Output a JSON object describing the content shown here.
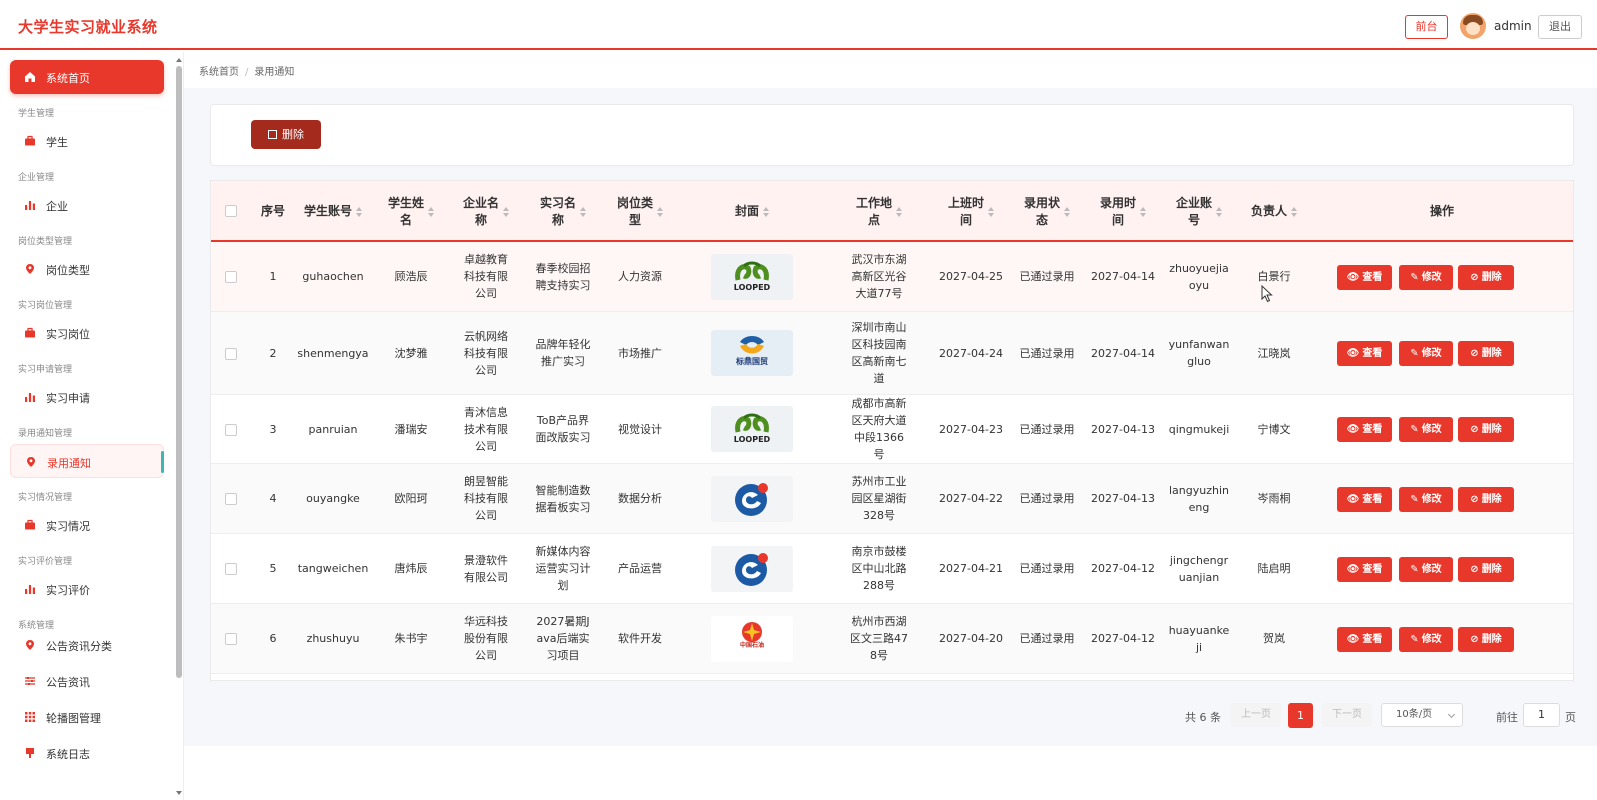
{
  "header": {
    "app_title": "大学生实习就业系统",
    "front_label": "前台",
    "username": "admin",
    "logout_label": "退出"
  },
  "sidebar": {
    "home": "系统首页",
    "groups": [
      {
        "title": "学生管理",
        "item": "学生",
        "icon": "briefcase-icon"
      },
      {
        "title": "企业管理",
        "item": "企业",
        "icon": "bar-chart-icon"
      },
      {
        "title": "岗位类型管理",
        "item": "岗位类型",
        "icon": "pin-icon"
      },
      {
        "title": "实习岗位管理",
        "item": "实习岗位",
        "icon": "briefcase-icon"
      },
      {
        "title": "实习申请管理",
        "item": "实习申请",
        "icon": "bar-chart-icon"
      },
      {
        "title": "录用通知管理",
        "item": "录用通知",
        "icon": "pin-icon"
      },
      {
        "title": "实习情况管理",
        "item": "实习情况",
        "icon": "briefcase-icon"
      },
      {
        "title": "实习评价管理",
        "item": "实习评价",
        "icon": "bar-chart-icon"
      }
    ],
    "system_group": "系统管理",
    "system_items": [
      "公告资讯分类",
      "公告资讯",
      "轮播图管理",
      "系统日志"
    ]
  },
  "breadcrumb": {
    "home": "系统首页",
    "current": "录用通知"
  },
  "toolbar": {
    "delete_label": "删除"
  },
  "table": {
    "headers": [
      "序号",
      "学生账号",
      "学生姓名",
      "企业名称",
      "实习名称",
      "岗位类型",
      "封面",
      "工作地点",
      "上班时间",
      "录用状态",
      "录用时间",
      "企业账号",
      "负责人",
      "操作"
    ],
    "rows": [
      {
        "no": "1",
        "account": "guhaochen",
        "name": "顾浩辰",
        "company": "卓越教育科技有限公司",
        "intern": "春季校园招聘支持实习",
        "type": "人力资源",
        "cover": "LOOPED",
        "location": "武汉市东湖高新区光谷大道77号",
        "start": "2027-04-25",
        "status": "已通过录用",
        "hired": "2027-04-14",
        "corp_account": "zhuoyuejiaoyu",
        "leader": "白景行"
      },
      {
        "no": "2",
        "account": "shenmengya",
        "name": "沈梦雅",
        "company": "云帆网络科技有限公司",
        "intern": "品牌年轻化推广实习",
        "type": "市场推广",
        "cover": "标鼎国贸",
        "location": "深圳市南山区科技园南区高新南七道",
        "start": "2027-04-24",
        "status": "已通过录用",
        "hired": "2027-04-14",
        "corp_account": "yunfanwangluo",
        "leader": "江晓岚"
      },
      {
        "no": "3",
        "account": "panruian",
        "name": "潘瑞安",
        "company": "青沐信息技术有限公司",
        "intern": "ToB产品界面改版实习",
        "type": "视觉设计",
        "cover": "LOOPED",
        "location": "成都市高新区天府大道中段1366号",
        "start": "2027-04-23",
        "status": "已通过录用",
        "hired": "2027-04-13",
        "corp_account": "qingmukeji",
        "leader": "宁博文"
      },
      {
        "no": "4",
        "account": "ouyangke",
        "name": "欧阳珂",
        "company": "朗昱智能科技有限公司",
        "intern": "智能制造数据看板实习",
        "type": "数据分析",
        "cover": "",
        "location": "苏州市工业园区星湖街328号",
        "start": "2027-04-22",
        "status": "已通过录用",
        "hired": "2027-04-13",
        "corp_account": "langyuzhineng",
        "leader": "岑雨桐"
      },
      {
        "no": "5",
        "account": "tangweichen",
        "name": "唐炜辰",
        "company": "景澄软件有限公司",
        "intern": "新媒体内容运营实习计划",
        "type": "产品运营",
        "cover": "",
        "location": "南京市鼓楼区中山北路288号",
        "start": "2027-04-21",
        "status": "已通过录用",
        "hired": "2027-04-12",
        "corp_account": "jingchengruanjian",
        "leader": "陆启明"
      },
      {
        "no": "6",
        "account": "zhushuyu",
        "name": "朱书宇",
        "company": "华远科技股份有限公司",
        "intern": "2027暑期Java后端实习项目",
        "type": "软件开发",
        "cover": "中国石油",
        "location": "杭州市西湖区文三路478号",
        "start": "2027-04-20",
        "status": "已通过录用",
        "hired": "2027-04-12",
        "corp_account": "huayuankeji",
        "leader": "贺岚"
      }
    ],
    "actions": {
      "view": "查看",
      "edit": "修改",
      "delete": "删除"
    }
  },
  "pagination": {
    "total": "共 6 条",
    "prev": "上一页",
    "current": "1",
    "next": "下一页",
    "size": "10条/页",
    "goto": "前往",
    "page_value": "1",
    "unit": "页"
  },
  "colors": {
    "accent": "#e8382c",
    "dark_accent": "#a52a1e",
    "header_bg": "#fff2f1"
  }
}
